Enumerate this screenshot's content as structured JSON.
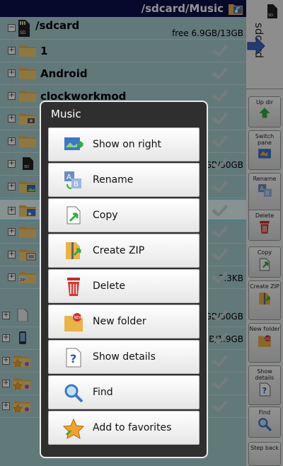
{
  "title": {
    "path_prefix": "/sdcard/",
    "path_current": "Music"
  },
  "side_tab": {
    "label": "sdcard"
  },
  "file_list": {
    "root": {
      "name": "/sdcard",
      "free_space": "free 6.9GB/13GB"
    },
    "rows": [
      {
        "name": "1",
        "meta": ""
      },
      {
        "name": "Android",
        "meta": ""
      },
      {
        "name": "clockworkmod",
        "meta": ""
      },
      {
        "name": "",
        "meta": ""
      },
      {
        "name": "",
        "meta": ""
      },
      {
        "name": "",
        "meta": "7GB/30GB"
      },
      {
        "name": "",
        "meta": ""
      },
      {
        "name": "",
        "meta": ""
      },
      {
        "name": "",
        "meta": ""
      },
      {
        "name": "",
        "meta": ""
      },
      {
        "name": "",
        "meta": "7.3KB"
      },
      {
        "name": "",
        "meta": "7GB/30GB"
      },
      {
        "name": "",
        "meta": "GB/1.9GB"
      },
      {
        "name": "",
        "meta": ""
      },
      {
        "name": "",
        "meta": ""
      },
      {
        "name": "",
        "meta": ""
      }
    ]
  },
  "toolbar": {
    "buttons": [
      {
        "label": "Up dir"
      },
      {
        "label": "Switch pane"
      },
      {
        "label": "Rename"
      },
      {
        "label": "Delete"
      },
      {
        "label": "Copy"
      },
      {
        "label": "Create ZIP"
      },
      {
        "label": "New folder"
      },
      {
        "label": "Show details"
      },
      {
        "label": "Find"
      },
      {
        "label": "Step back"
      }
    ]
  },
  "dialog": {
    "title": "Music",
    "items": [
      {
        "label": "Show on right",
        "icon": "show-on-right-icon"
      },
      {
        "label": "Rename",
        "icon": "rename-icon"
      },
      {
        "label": "Copy",
        "icon": "copy-icon"
      },
      {
        "label": "Create ZIP",
        "icon": "zip-icon"
      },
      {
        "label": "Delete",
        "icon": "trash-icon"
      },
      {
        "label": "New folder",
        "icon": "new-folder-icon"
      },
      {
        "label": "Show details",
        "icon": "details-icon"
      },
      {
        "label": "Find",
        "icon": "magnifier-icon"
      },
      {
        "label": "Add to favorites",
        "icon": "star-icon"
      }
    ]
  },
  "colors": {
    "titlebar": "#0c0f4d",
    "list_background": "#a9d0d2",
    "dialog_background": "#2f2f2f",
    "selection": "#e8fbfc"
  }
}
